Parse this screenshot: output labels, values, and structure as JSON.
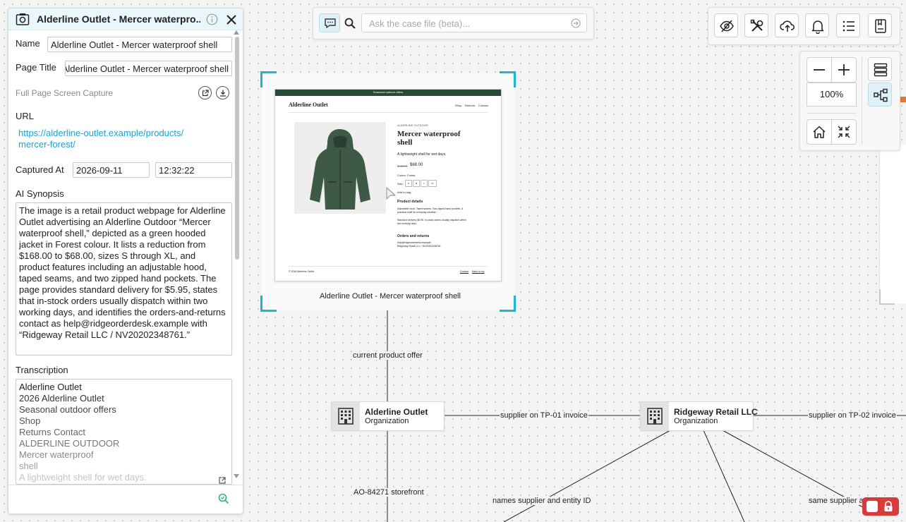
{
  "panel": {
    "title": "Alderline Outlet - Mercer waterpro...",
    "name_label": "Name",
    "name_value": "Alderline Outlet - Mercer waterproof shell",
    "page_title_label": "Page Title",
    "page_title_value": "Alderline Outlet - Mercer waterproof shell",
    "capture_type": "Full Page Screen Capture",
    "url_label": "URL",
    "url_line1": "https://alderline-outlet.example/products/",
    "url_line2": "mercer-forest/",
    "captured_label": "Captured At",
    "captured_date": "2026-09-11",
    "captured_time": "12:32:22",
    "synopsis_label": "AI Synopsis",
    "synopsis": "The image is a retail product webpage for Alderline Outlet advertising an Alderline Outdoor “Mercer waterproof shell,” depicted as a green hooded jacket in Forest colour. It lists a reduction from $168.00 to $68.00, sizes S through XL, and product features including an adjustable hood, taped seams, and two zipped hand pockets. The page provides standard delivery for $5.95, states that in-stock orders usually dispatch within two working days, and identifies the orders-and-returns contact as help@ridgeorderdesk.example with “Ridgeway Retail LLC / NV20202348761.”",
    "transcription_label": "Transcription",
    "transcription": [
      "Alderline Outlet",
      "2026 Alderline Outlet",
      "Seasonal outdoor offers",
      "Shop",
      "Returns Contact",
      "ALDERLINE OUTDOOR",
      "Mercer waterproof",
      "shell",
      "A lightweight shell for wet days."
    ]
  },
  "search": {
    "placeholder": "Ask the case file (beta)..."
  },
  "zoom": {
    "level": "100%"
  },
  "screenshot": {
    "caption": "Alderline Outlet - Mercer waterproof shell",
    "banner": "Seasonal outdoor offers",
    "brand": "Alderline Outlet",
    "nav": [
      "Shop",
      "Returns",
      "Contact"
    ],
    "eyebrow": "ALDERLINE OUTDOOR",
    "product_line1": "Mercer waterproof",
    "product_line2": "shell",
    "tagline": "A lightweight shell for wet days.",
    "old_price": "$168.00",
    "price": "$68.00",
    "colour": "Colour: Forest",
    "size_label": "Size:",
    "sizes": [
      "S",
      "M",
      "L",
      "XL"
    ],
    "add_to_bag": "Add to bag",
    "details_heading": "Product details",
    "details_text1": "Adjustable hood. Taped seams. Two zipped hand pockets. A",
    "details_text2": "practical shell for everyday weather.",
    "delivery_text1": "Standard delivery $5.95. In-stock orders usually dispatch within",
    "delivery_text2": "two working days.",
    "orders_heading": "Orders and returns",
    "orders_email": "help@ridgeorderdesk.example",
    "orders_entity": "Ridgeway Retail LLC / NV20202348761",
    "footer_left": "© 2026 Alderline Outlet",
    "footer_links": [
      "Contact",
      "Back to top"
    ]
  },
  "graph": {
    "edge_current_offer": "current product offer",
    "edge_storefront": "AO-84271 storefront",
    "edge_supplier_tp01": "supplier on TP-01 invoice",
    "edge_supplier_tp02": "supplier on TP-02 invoice",
    "edge_names_supplier": "names supplier and entity ID",
    "edge_same_supplier": "same supplier ar",
    "node_alderline_title": "Alderline Outlet",
    "node_alderline_type": "Organization",
    "node_ridgeway_title": "Ridgeway Retail LLC",
    "node_ridgeway_type": "Organization"
  },
  "colors": {
    "accent": "#1aa3d6",
    "frame": "#19b6d8",
    "badge": "#d93a3a",
    "jacket": "#3e5a46"
  }
}
